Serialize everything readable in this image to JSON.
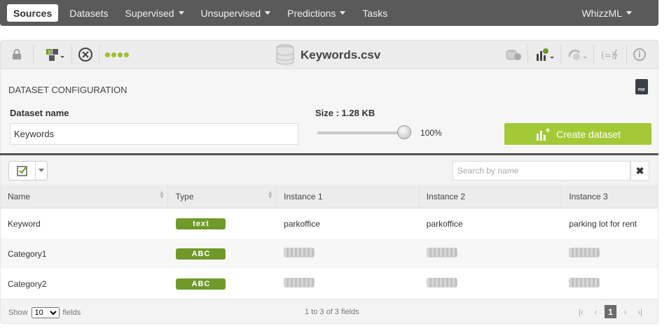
{
  "nav": {
    "sources": "Sources",
    "datasets": "Datasets",
    "supervised": "Supervised",
    "unsupervised": "Unsupervised",
    "predictions": "Predictions",
    "tasks": "Tasks",
    "whizzml": "WhizzML"
  },
  "toolbar": {
    "title": "Keywords.csv",
    "icons": [
      "lock-icon",
      "source-config-icon",
      "cancel-icon",
      "status-dots-icon",
      "database-icon",
      "datasets-icon",
      "dataset-actions-icon",
      "model-icon",
      "formula-icon",
      "info-icon"
    ]
  },
  "config": {
    "title": "DATASET CONFIGURATION",
    "pdf_label": "PDF",
    "name_label": "Dataset name",
    "name_value": "Keywords",
    "size_label": "Size : 1.28 KB",
    "percent": "100%",
    "percent_value": 100,
    "create_label": "Create dataset"
  },
  "filter": {
    "search_placeholder": "Search by name",
    "clear": "✖"
  },
  "table": {
    "headers": [
      "Name",
      "Type",
      "Instance 1",
      "Instance 2",
      "Instance 3"
    ],
    "rows": [
      {
        "name": "Keyword",
        "type": "text",
        "i1": "parkoffice",
        "i2": "parkoffice",
        "i3": "parking lot for rent"
      },
      {
        "name": "Category1",
        "type": "ABC",
        "i1": "",
        "i2": "",
        "i3": ""
      },
      {
        "name": "Category2",
        "type": "ABC",
        "i1": "",
        "i2": "",
        "i3": ""
      }
    ]
  },
  "footer": {
    "show": "Show",
    "per_page": "10",
    "fields": "fields",
    "info": "1 to 3 of 3 fields",
    "current_page": "1"
  },
  "colors": {
    "accent": "#a3c936",
    "type_badge": "#6f9a2a",
    "nav_bg": "#5a5a5a"
  }
}
